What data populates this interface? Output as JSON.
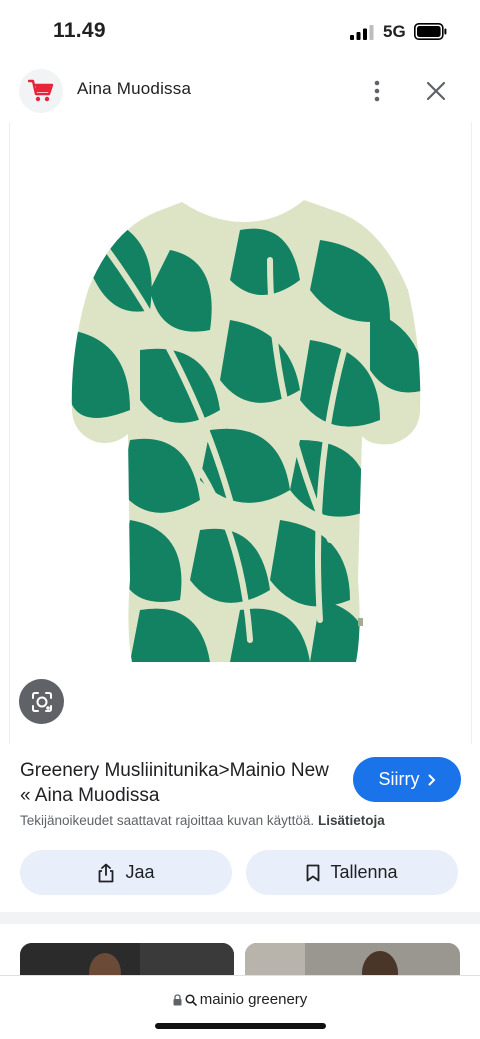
{
  "status_bar": {
    "time": "11.49",
    "network": "5G"
  },
  "header": {
    "site_name": "Aina Muodissa",
    "logo_icon": "shopping-cart-icon",
    "accent_color": "#e8233a"
  },
  "image": {
    "description_icon": "tunic-image",
    "print_colors": [
      "#128262",
      "#dde4c6"
    ]
  },
  "result": {
    "title": "Greenery Musliinitunika>Mainio New « Aina Muodissa",
    "go_label": "Siirry",
    "copyright_text": "Tekijänoikeudet saattavat rajoittaa kuvan käyttöä.",
    "copyright_more": "Lisätietoja"
  },
  "actions": {
    "share_label": "Jaa",
    "save_label": "Tallenna"
  },
  "address_bar": {
    "query": "mainio greenery"
  },
  "colors": {
    "primary_button": "#1a73e8",
    "pill_background": "#e8eefa"
  }
}
